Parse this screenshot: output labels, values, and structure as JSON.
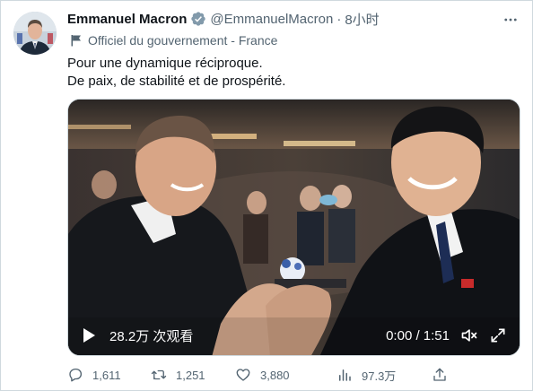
{
  "author": {
    "display_name": "Emmanuel Macron",
    "handle": "@EmmanuelMacron",
    "separator": "·",
    "time": "8小时",
    "verified": true,
    "affiliation": "Officiel du gouvernement - France"
  },
  "tweet": {
    "lines": [
      "Pour une dynamique réciproque.",
      "De paix, de stabilité et de prospérité."
    ]
  },
  "video": {
    "view_count": "28.2万 次观看",
    "time": "0:00 / 1:51"
  },
  "actions": {
    "reply_count": "1,611",
    "retweet_count": "1,251",
    "like_count": "3,880",
    "view_count": "97.3万"
  },
  "icons": {
    "verified": "verified-badge-icon",
    "affiliation": "flag-icon",
    "more": "more-options-icon",
    "play": "play-icon",
    "volume": "volume-icon",
    "fullscreen": "fullscreen-icon",
    "reply": "reply-icon",
    "retweet": "retweet-icon",
    "like": "heart-icon",
    "views": "bar-chart-icon",
    "share": "share-icon"
  },
  "colors": {
    "text_primary": "#0f1419",
    "text_secondary": "#536471",
    "border": "#cfd9de",
    "verified_badge": "#829aab"
  }
}
